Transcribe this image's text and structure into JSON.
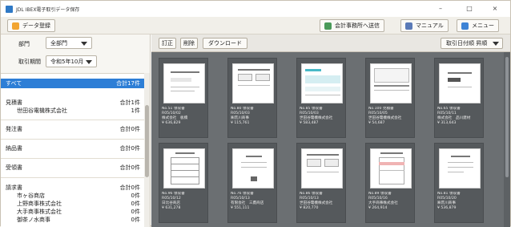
{
  "window": {
    "title": "JDL IBEX電子取引データ保存",
    "controls": [
      "–",
      "□",
      "×"
    ]
  },
  "toolbar": {
    "register_label": "データ登録",
    "send_label": "会計事務所へ送信",
    "manual_label": "マニュアル",
    "menu_label": "メニュー"
  },
  "filters": {
    "dept_label": "部門",
    "dept_value": "全部門",
    "period_label": "取引期間",
    "period_value": "令和5年10月"
  },
  "list": [
    {
      "label": "すべて",
      "count": "合計17件",
      "selected": true,
      "sub": false
    },
    {
      "label": "見積書",
      "count": "合計1件",
      "selected": false,
      "sub": false
    },
    {
      "label": "世田谷電機株式会社",
      "count": "1件",
      "selected": false,
      "sub": true
    },
    {
      "label": "発注書",
      "count": "合計0件",
      "selected": false,
      "sub": false
    },
    {
      "label": "納品書",
      "count": "合計0件",
      "selected": false,
      "sub": false
    },
    {
      "label": "受領書",
      "count": "合計0件",
      "selected": false,
      "sub": false
    },
    {
      "label": "請求書",
      "count": "合計0件",
      "selected": false,
      "sub": false
    },
    {
      "label": "市ヶ谷商店",
      "count": "0件",
      "selected": false,
      "sub": true
    },
    {
      "label": "上野商事株式会社",
      "count": "0件",
      "selected": false,
      "sub": true
    },
    {
      "label": "大手商事株式会社",
      "count": "0件",
      "selected": false,
      "sub": true
    },
    {
      "label": "御茶ノ水商事",
      "count": "0件",
      "selected": false,
      "sub": true
    }
  ],
  "main_toolbar": {
    "correct_label": "訂正",
    "delete_label": "削除",
    "download_label": "ダウンロード",
    "sort_label": "取引日付順 昇順"
  },
  "cards": [
    {
      "lines": [
        "No.51 領収書",
        "R05/10/02",
        "株式会社　板橋",
        "¥ 636,829"
      ]
    },
    {
      "lines": [
        "No.80 領収書",
        "R05/10/03",
        "㈱荒川商事",
        "¥ 115,761"
      ]
    },
    {
      "lines": [
        "No.85 領収書",
        "R05/10/03",
        "世田谷電機株式会社",
        "¥ 583,487"
      ]
    },
    {
      "lines": [
        "No.100 見積書",
        "R05/10/05",
        "世田谷電機株式会社",
        "¥ 54,687"
      ]
    },
    {
      "lines": [
        "No.65 領収書",
        "R05/10/11",
        "株式会社　品川建材",
        "¥ 313,643"
      ]
    },
    {
      "lines": [
        "No.96 領収書",
        "R05/10/12",
        "日比谷商店",
        "¥ 631,278"
      ]
    },
    {
      "lines": [
        "No.76 領収書",
        "R05/10/13",
        "有限会社　三鷹商店",
        "¥ 551,111"
      ]
    },
    {
      "lines": [
        "No.86 領収書",
        "R05/10/13",
        "世田谷電機株式会社",
        "¥ 820,770"
      ]
    },
    {
      "lines": [
        "No.89 領収書",
        "R05/10/16",
        "大手商事株式会社",
        "¥ 264,914"
      ]
    },
    {
      "lines": [
        "No.81 領収書",
        "R05/10/20",
        "㈱荒川商事",
        "¥ 536,879"
      ]
    }
  ],
  "colors": {
    "selection": "#2d7ed6",
    "content_bg": "#6b6f72"
  }
}
